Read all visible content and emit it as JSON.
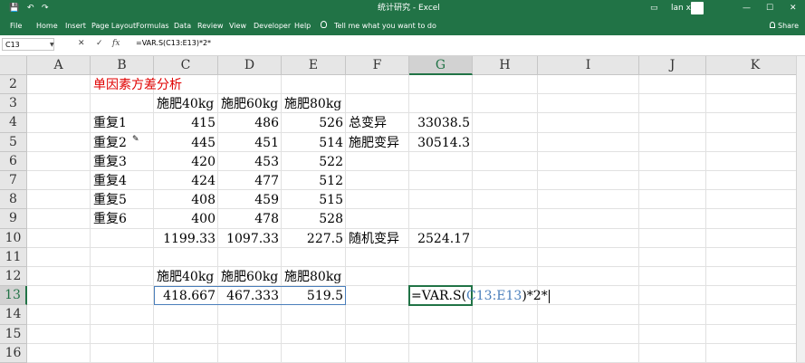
{
  "titlebar": {
    "title": "统计研究 - Excel",
    "user": "lan xl",
    "save_glyph": "💾",
    "undo_glyph": "↶",
    "redo_glyph": "↷",
    "min_glyph": "—",
    "max_glyph": "☐",
    "close_glyph": "✕",
    "restore_glyph": "▭"
  },
  "ribbon": {
    "tabs": [
      "File",
      "Home",
      "Insert",
      "Page Layout",
      "Formulas",
      "Data",
      "Review",
      "View",
      "Developer",
      "Help"
    ],
    "tellme": "Tell me what you want to do",
    "share": "Share"
  },
  "formula_bar": {
    "name_box": "C13",
    "formula": "=VAR.S(C13:E13)*2*",
    "cancel": "✕",
    "enter": "✓",
    "fx": "fx"
  },
  "columns": [
    "A",
    "B",
    "C",
    "D",
    "E",
    "F",
    "G",
    "H",
    "I",
    "J",
    "K"
  ],
  "rows": [
    "2",
    "3",
    "4",
    "5",
    "6",
    "7",
    "8",
    "9",
    "10",
    "11",
    "12",
    "13",
    "14",
    "15",
    "16"
  ],
  "cells": {
    "B2": "单因素方差分析",
    "C3": "施肥40kg",
    "D3": "施肥60kg",
    "E3": "施肥80kg",
    "B4": "重复1",
    "C4": "415",
    "D4": "486",
    "E4": "526",
    "F4": "总变异",
    "G4": "33038.5",
    "B5": "重复2",
    "C5": "445",
    "D5": "451",
    "E5": "514",
    "F5": "施肥变异",
    "G5": "30514.3",
    "B6": "重复3",
    "C6": "420",
    "D6": "453",
    "E6": "522",
    "B7": "重复4",
    "C7": "424",
    "D7": "477",
    "E7": "512",
    "B8": "重复5",
    "C8": "408",
    "D8": "459",
    "E8": "515",
    "B9": "重复6",
    "C9": "400",
    "D9": "478",
    "E9": "528",
    "C10": "1199.33",
    "D10": "1097.33",
    "E10": "227.5",
    "F10": "随机变异",
    "G10": "2524.17",
    "C12": "施肥40kg",
    "D12": "施肥60kg",
    "E12": "施肥80kg",
    "C13": "418.667",
    "D13": "467.333",
    "E13": "519.5"
  },
  "edit_cell": {
    "prefix": "=VAR.S(",
    "ref": "C13:E13",
    "suffix": ")*2*",
    "ref_color": "#4a7ebb"
  },
  "colors": {
    "accent": "#217346",
    "title_red": "#e00000"
  }
}
